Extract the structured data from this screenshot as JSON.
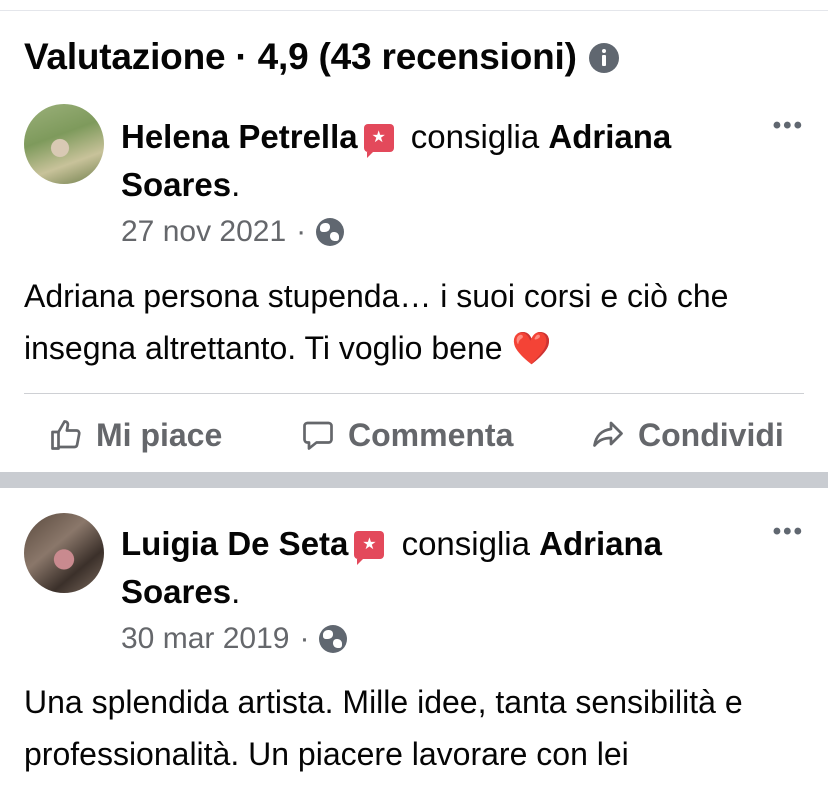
{
  "section": {
    "title": "Valutazione · 4,9 (43 recensioni)"
  },
  "reviews": [
    {
      "name": "Helena Petrella",
      "verb": "consiglia",
      "target": "Adriana Soares",
      "date": "27 nov 2021",
      "text": "Adriana persona stupenda… i suoi corsi e ciò che insegna altrettanto. Ti voglio bene",
      "emoji": "❤️"
    },
    {
      "name": "Luigia De Seta",
      "verb": "consiglia",
      "target": "Adriana Soares",
      "date": "30 mar 2019",
      "text": "Una splendida artista. Mille idee, tanta sensibilità e professionalità. Un piacere lavorare con lei"
    }
  ],
  "actions": {
    "like": "Mi piace",
    "comment": "Commenta",
    "share": "Condividi"
  },
  "symbols": {
    "more": "•••",
    "dot": "·",
    "period": "."
  },
  "icons": [
    "info-icon",
    "recommend-icon",
    "globe-icon",
    "more-options-icon",
    "like-icon",
    "comment-icon",
    "share-icon"
  ]
}
